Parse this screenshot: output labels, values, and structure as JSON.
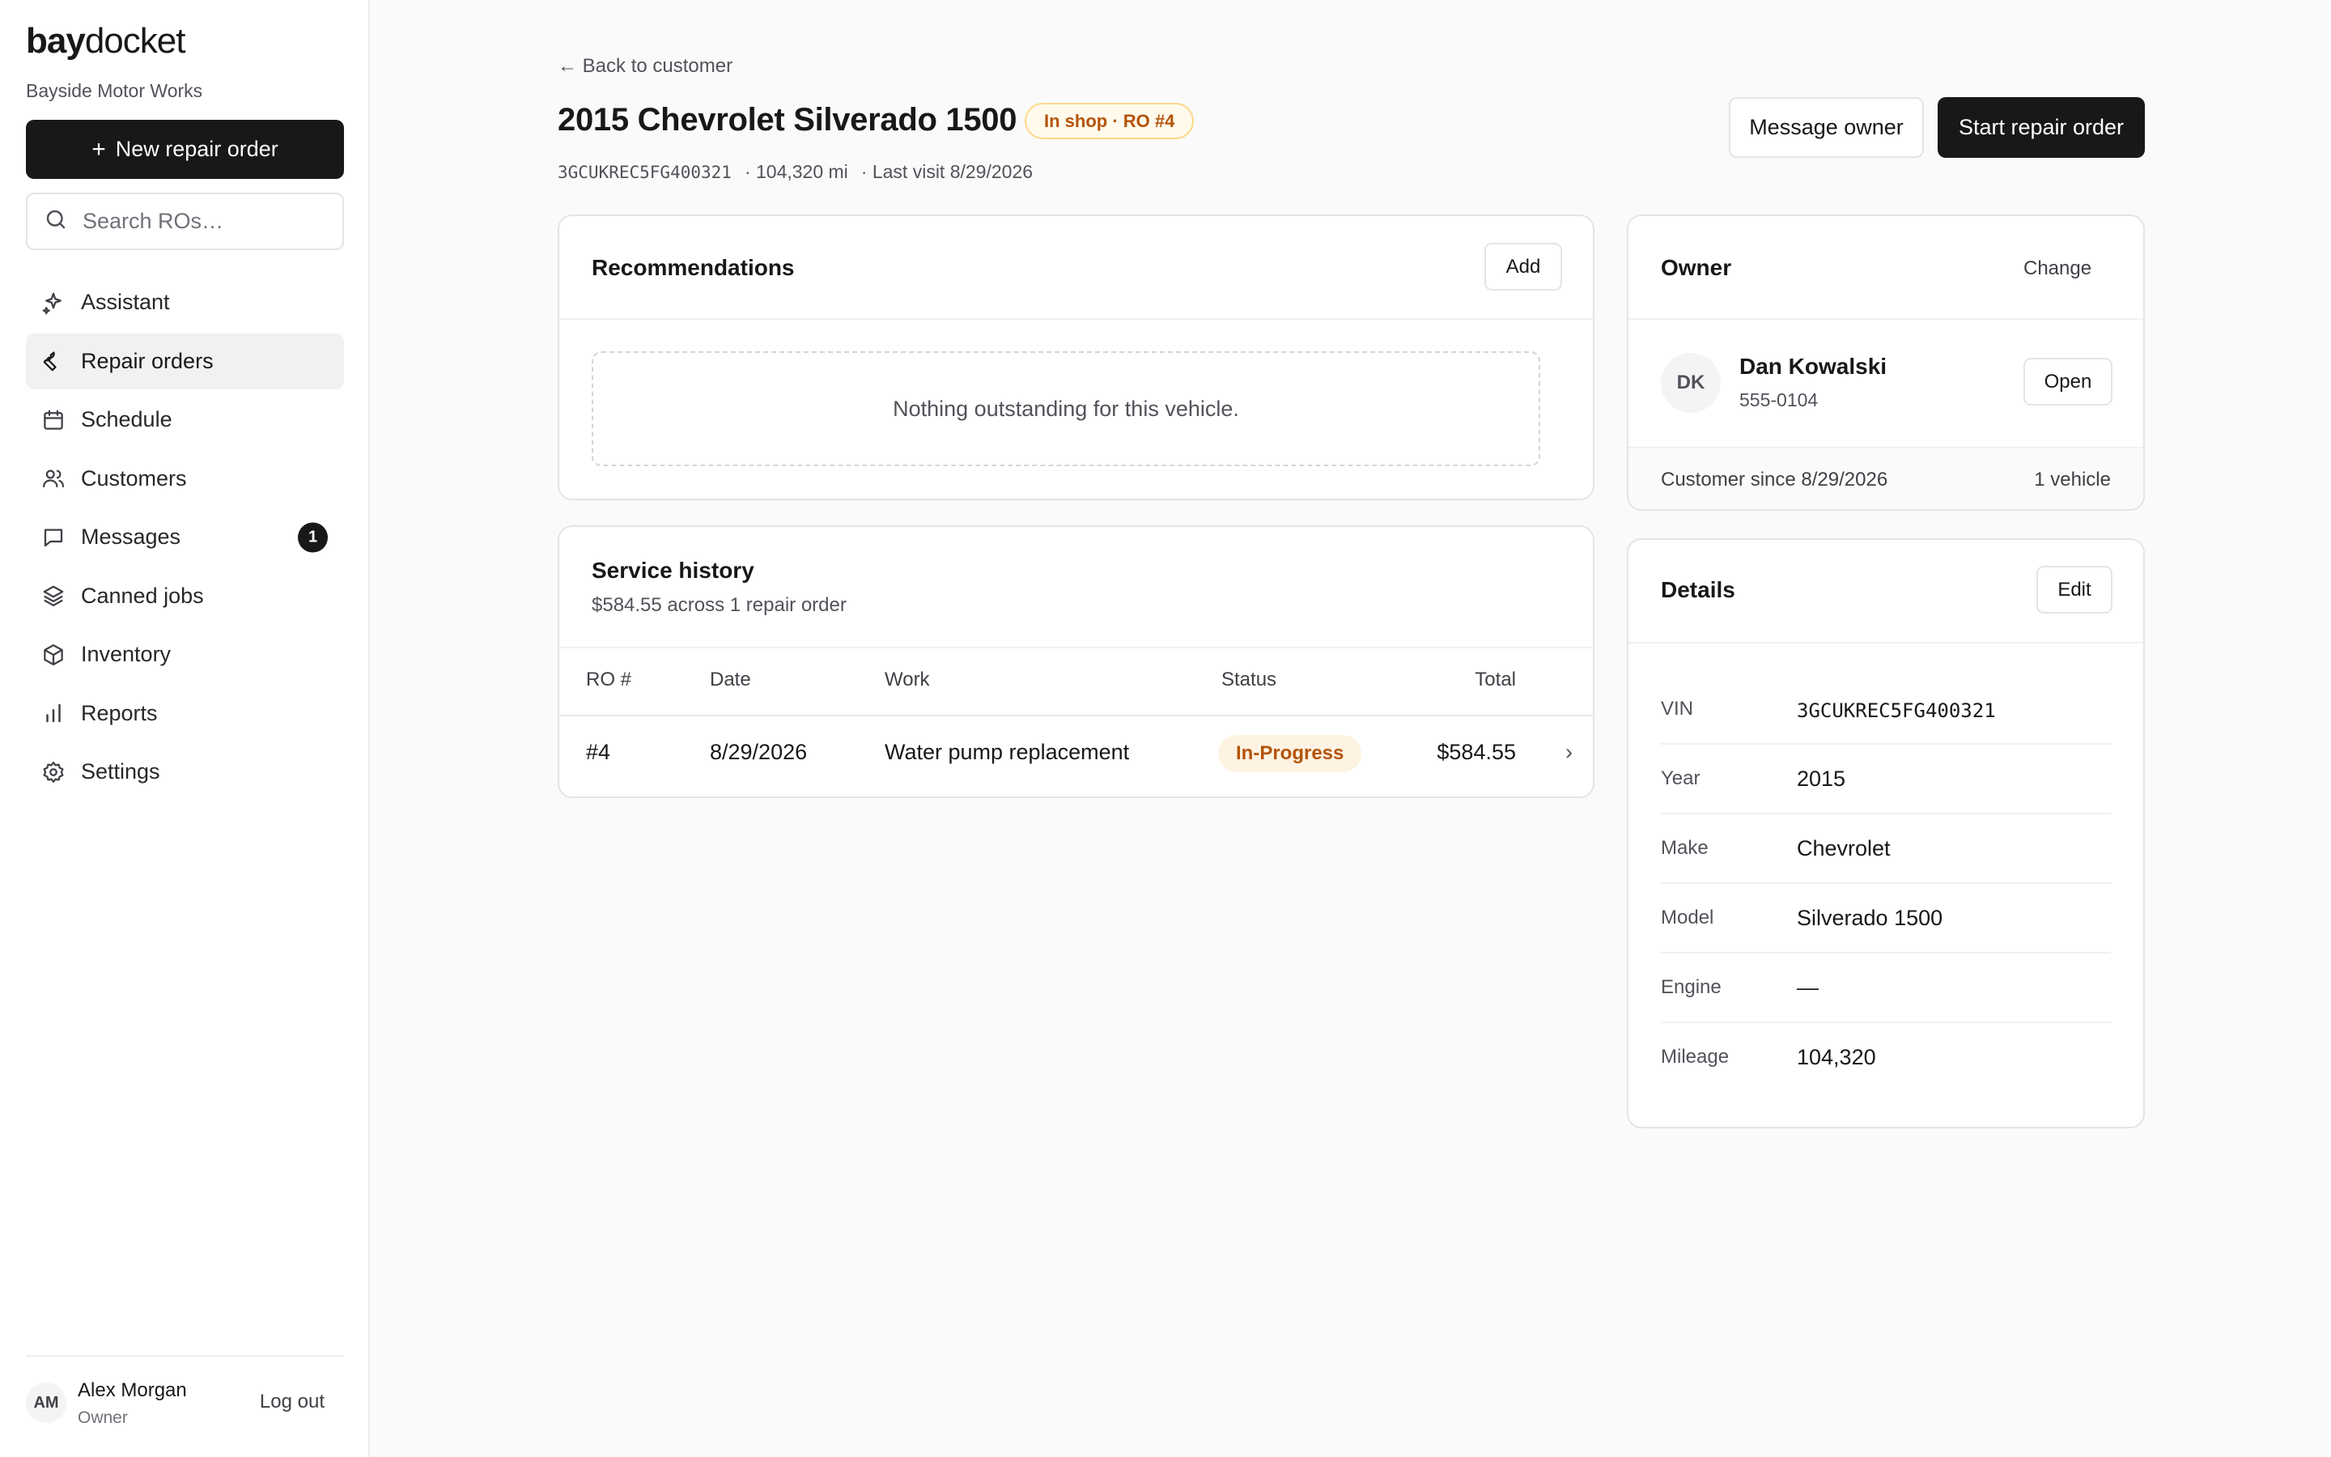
{
  "brand": {
    "bold": "bay",
    "light": "docket",
    "shop_name": "Bayside Motor Works"
  },
  "sidebar": {
    "new_button": {
      "icon": "+",
      "label": "New repair order"
    },
    "search_placeholder": "Search ROs…",
    "items": [
      {
        "label": "Assistant",
        "icon": "sparkle-icon"
      },
      {
        "label": "Repair orders",
        "icon": "wrench-icon",
        "active": true
      },
      {
        "label": "Schedule",
        "icon": "calendar-icon"
      },
      {
        "label": "Customers",
        "icon": "users-icon"
      },
      {
        "label": "Messages",
        "icon": "message-icon",
        "badge": "1"
      },
      {
        "label": "Canned jobs",
        "icon": "layers-icon"
      },
      {
        "label": "Inventory",
        "icon": "box-icon"
      },
      {
        "label": "Reports",
        "icon": "bar-chart-icon"
      },
      {
        "label": "Settings",
        "icon": "gear-icon"
      }
    ],
    "user": {
      "initials": "AM",
      "name": "Alex Morgan",
      "role": "Owner",
      "logout": "Log out"
    }
  },
  "header": {
    "back_link": "← Back to customer",
    "title": "2015 Chevrolet Silverado 1500",
    "status": "In shop · RO #4",
    "vin": "3GCUKREC5FG400321",
    "mileage": "· 104,320 mi",
    "last_visit": "· Last visit 8/29/2026",
    "message_button": "Message owner",
    "start_button": "Start repair order"
  },
  "recommendations": {
    "title": "Recommendations",
    "add_button": "Add",
    "empty_text": "Nothing outstanding for this vehicle."
  },
  "service_history": {
    "title": "Service history",
    "summary": "$584.55 across 1 repair order",
    "columns": [
      "RO #",
      "Date",
      "Work",
      "Status",
      "Total"
    ],
    "rows": [
      {
        "ro": "#4",
        "date": "8/29/2026",
        "work": "Water pump replacement",
        "status": "In-Progress",
        "total": "$584.55",
        "chevron": "›"
      }
    ]
  },
  "owner": {
    "title": "Owner",
    "change_button": "Change",
    "initials": "DK",
    "name": "Dan Kowalski",
    "phone": "555-0104",
    "open_button": "Open",
    "customer_since": "Customer since 8/29/2026",
    "vehicles": "1 vehicle"
  },
  "details": {
    "title": "Details",
    "edit_button": "Edit",
    "fields": [
      {
        "label": "VIN",
        "value": "3GCUKREC5FG400321"
      },
      {
        "label": "Year",
        "value": "2015"
      },
      {
        "label": "Make",
        "value": "Chevrolet"
      },
      {
        "label": "Model",
        "value": "Silverado 1500"
      },
      {
        "label": "Engine",
        "value": "—"
      },
      {
        "label": "Mileage",
        "value": "104,320"
      }
    ]
  },
  "colors": {
    "accent": "#18181b",
    "status_amber": "#b45309",
    "status_bg": "#fef3e2",
    "background": "#fafafa"
  }
}
